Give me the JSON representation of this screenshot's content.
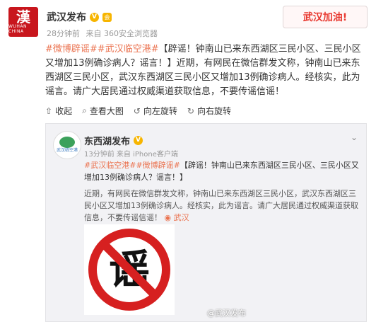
{
  "author": {
    "avatar_text": "漢",
    "avatar_subtext": "WUHAN CHINA",
    "name": "武汉发布",
    "time": "28分钟前",
    "source": "来自 360安全浏览器"
  },
  "header_badge": "武汉加油!",
  "post": {
    "tags": [
      "#微博辟谣#",
      "#武汉临空港#"
    ],
    "text": "【辟谣！钟南山已来东西湖区三民小区、三民小区又增加13例确诊病人？谣言！】近期，有网民在微信群发文称，钟南山已来东西湖区三民小区，武汉东西湖区三民小区又增加13例确诊病人。经核实，此为谣言。请广大居民通过权威渠道获取信息，不要传谣信谣！"
  },
  "toolbar": {
    "collapse": "收起",
    "view_large": "查看大图",
    "rotate_left": "向左旋转",
    "rotate_right": "向右旋转"
  },
  "repost": {
    "avatar_subtext": "武汉临空港",
    "name": "东西湖发布",
    "time": "13分钟前",
    "source": "来自 iPhone客户端",
    "tags": "#武汉临空港##微博辟谣#",
    "headline": "【辟谣！钟南山已来东西湖区三民小区、三民小区又增加13例确诊病人？谣言！】",
    "body": "近期，有网民在微信群发文称，钟南山已来东西湖区三民小区，武汉东西湖区三民小区又增加13例确诊病人。经核实，此为谣言。请广大居民通过权威渠道获取信息，不要传谣信谣！",
    "location": "武汉",
    "image_text": "谣",
    "watermark": "@武汉发布"
  },
  "colors": {
    "accent": "#eb7350",
    "brand_red": "#c8161d",
    "verify": "#f7b500"
  }
}
